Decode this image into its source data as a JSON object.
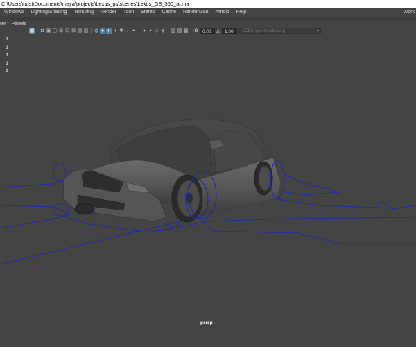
{
  "window": {
    "title_path": "C:\\Users\\host\\Documents\\maya\\projects\\Lexus_gs\\scenes\\Lexus_GS_350_ai.ma"
  },
  "menubar": {
    "items": [
      "Windows",
      "Lighting/Shading",
      "Texturing",
      "Render",
      "Toon",
      "Stereo",
      "Cache",
      "RenderMan",
      "Arnold",
      "Help"
    ],
    "workspace_label": "Work"
  },
  "panel_menus": [
    "rer",
    "Panels"
  ],
  "toolbar": {
    "exposure_value": "0.00",
    "gamma_value": "1.00",
    "color_space_placeholder": "ACES (gamma display)",
    "icons": [
      "grid-icon",
      "camera-icon",
      "bookmark-icon",
      "film-gate-icon",
      "resolution-gate-icon",
      "gate-mask-icon",
      "field-chart-icon",
      "safe-action-icon",
      "safe-title-icon",
      "wireframe-icon",
      "smooth-shade-icon",
      "default-material-icon",
      "textured-icon",
      "use-all-lights-icon",
      "shadows-icon",
      "ambient-occlusion-icon",
      "motion-blur-icon",
      "anti-aliasing-icon",
      "isolate-select-icon",
      "xray-icon",
      "xray-joints-icon",
      "xray-active-icon",
      "backface-icon",
      "exposure-icon",
      "gamma-icon"
    ]
  },
  "viewport": {
    "hud_values": [
      "0",
      "0",
      "0",
      "0",
      "0"
    ],
    "camera_label": "persp",
    "colors": {
      "background": "#444444",
      "curve": "#1f2aa6",
      "car_body": "#5a5a5a"
    }
  }
}
